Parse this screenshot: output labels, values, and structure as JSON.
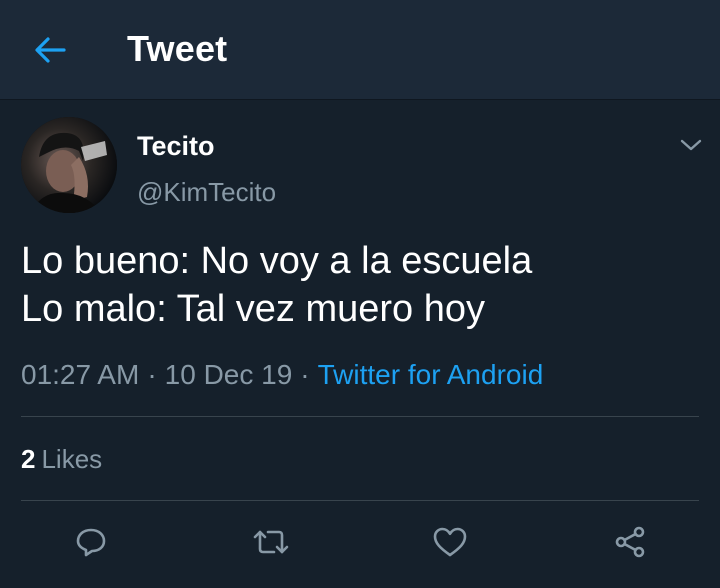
{
  "header": {
    "title": "Tweet",
    "back_icon": "back-arrow-icon",
    "accent_color": "#1da1f2"
  },
  "tweet": {
    "author": {
      "display_name": "Tecito",
      "handle": "@KimTecito"
    },
    "text_lines": [
      "Lo bueno: No voy a la escuela",
      "Lo malo: Tal vez muero hoy"
    ],
    "time": "01:27 AM",
    "separator": "·",
    "date": "10 Dec 19",
    "source": "Twitter for Android",
    "likes": {
      "count": "2",
      "label": "Likes"
    },
    "actions": [
      "reply-icon",
      "retweet-icon",
      "like-icon",
      "share-icon"
    ]
  },
  "theme": {
    "background": "#15202b",
    "header_background": "#1c2938",
    "secondary_text": "#8899a6",
    "link": "#1da1f2",
    "divider": "#38444d"
  }
}
